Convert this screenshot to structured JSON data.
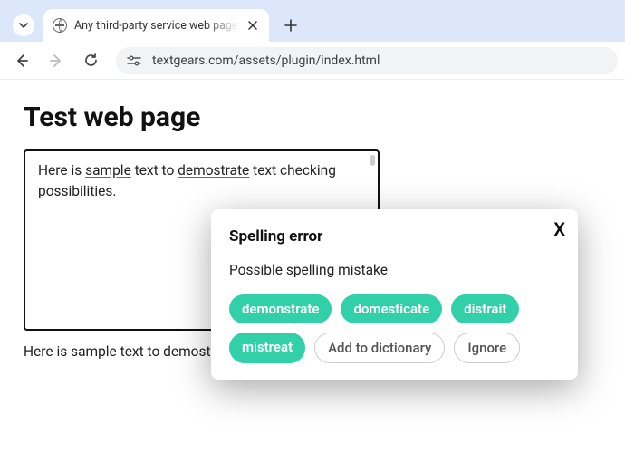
{
  "browser": {
    "tab_title": "Any third-party service web page",
    "url": "textgears.com/assets/plugin/index.html"
  },
  "page": {
    "title": "Test web page",
    "editor_parts": {
      "p0": "Here is ",
      "p1": "sample",
      "p2": " text to ",
      "p3": "demostrate",
      "p4": " text checking possibilities."
    },
    "below_text": "Here is sample text to demostrate text checking possibilities."
  },
  "popup": {
    "title": "Spelling error",
    "description": "Possible spelling mistake",
    "suggestions": {
      "s0": "demonstrate",
      "s1": "domesticate",
      "s2": "distrait",
      "s3": "mistreat"
    },
    "actions": {
      "add": "Add to dictionary",
      "ignore": "Ignore"
    },
    "close": "X"
  }
}
